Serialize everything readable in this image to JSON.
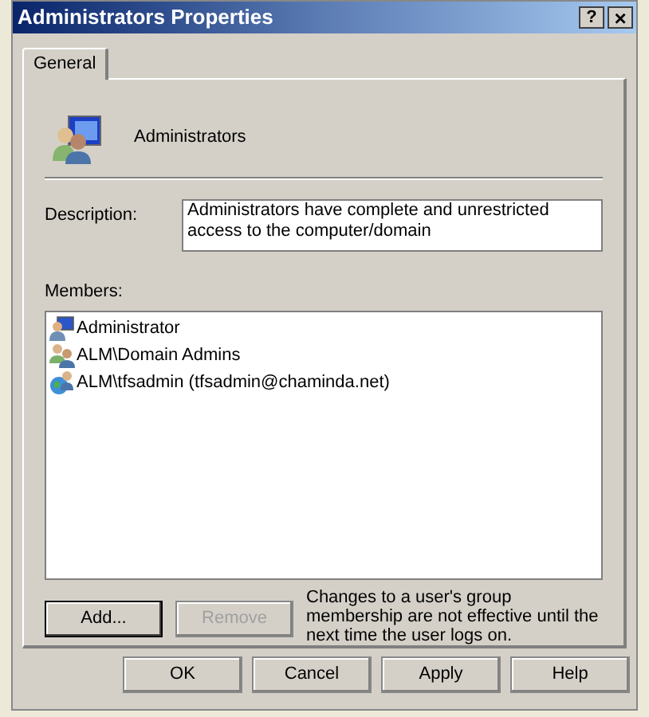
{
  "window": {
    "title": "Administrators Properties",
    "controls": [
      {
        "kind": "help",
        "label": "?"
      },
      {
        "kind": "close",
        "label": "×"
      }
    ]
  },
  "tabs": [
    {
      "label": "General",
      "selected": true
    }
  ],
  "group": {
    "name": "Administrators"
  },
  "description": {
    "label": "Description:",
    "value": "Administrators have complete and unrestricted access to the computer/domain"
  },
  "members": {
    "label": "Members:",
    "items": [
      {
        "kind": "user",
        "name": "Administrator"
      },
      {
        "kind": "group",
        "name": "ALM\\Domain Admins"
      },
      {
        "kind": "domain_user",
        "name": "ALM\\tfsadmin (tfsadmin@chaminda.net)"
      }
    ]
  },
  "member_buttons": [
    {
      "label": "Add...",
      "default": true,
      "disabled": false
    },
    {
      "label": "Remove",
      "default": false,
      "disabled": true
    }
  ],
  "note": "Changes to a user's group membership are not effective until the next time the user logs on.",
  "buttons": [
    {
      "label": "OK"
    },
    {
      "label": "Cancel"
    },
    {
      "label": "Apply"
    },
    {
      "label": "Help"
    }
  ]
}
